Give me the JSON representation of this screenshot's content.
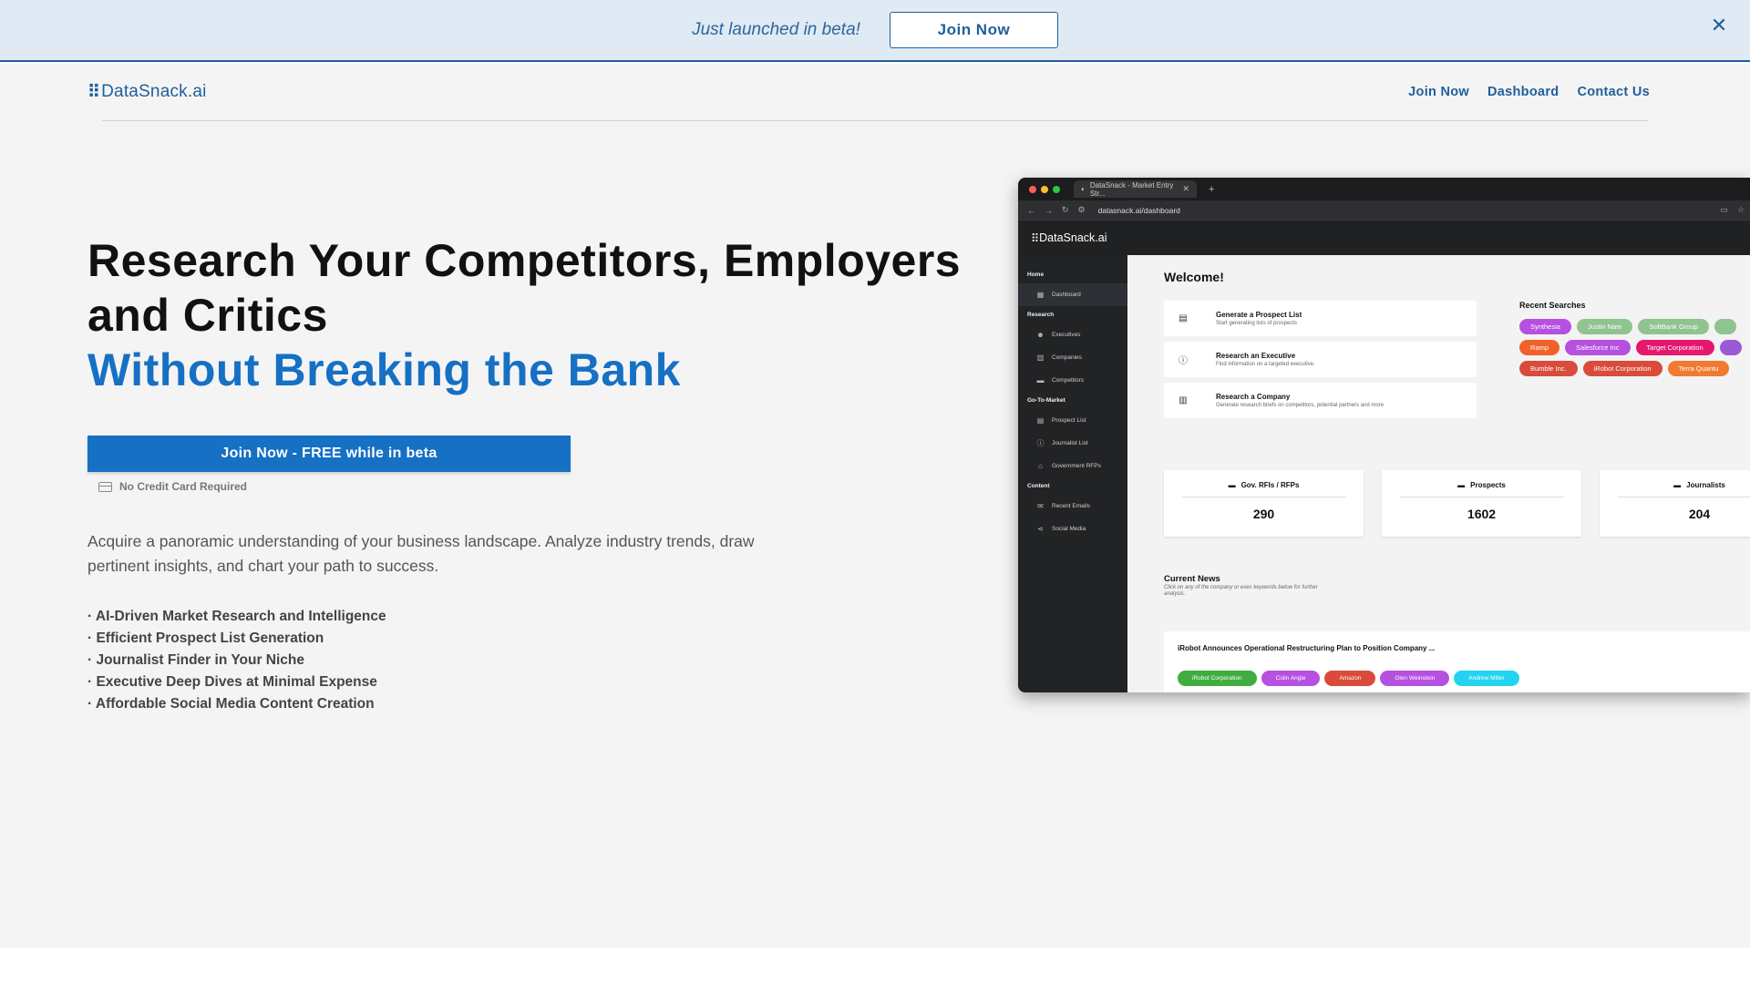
{
  "banner": {
    "text": "Just launched in beta!",
    "button": "Join Now",
    "close": "✕"
  },
  "nav": {
    "logo_mark": "⠿",
    "logo": "DataSnack.ai",
    "links": [
      "Join Now",
      "Dashboard",
      "Contact Us"
    ]
  },
  "hero": {
    "title_line1": "Research Your Competitors, Employers",
    "title_line2": "and Critics",
    "title_accent": "Without Breaking the Bank",
    "cta": "Join Now - FREE while in beta",
    "no_card": "No Credit Card Required",
    "description": "Acquire a panoramic understanding of your business landscape. Analyze industry trends, draw pertinent insights, and chart your path to success.",
    "features": [
      "· AI-Driven Market Research and Intelligence",
      "· Efficient Prospect List Generation",
      "· Journalist Finder in Your Niche",
      "· Executive Deep Dives at Minimal Expense",
      "· Affordable Social Media Content Creation"
    ]
  },
  "mock": {
    "tab_title": "DataSnack - Market Entry Str...",
    "url": "datasnack.ai/dashboard",
    "app_logo": "DataSnack.ai",
    "sidebar": {
      "home": "Home",
      "dashboard": "Dashboard",
      "research": "Research",
      "executives": "Executives",
      "companies": "Companies",
      "competitors": "Competitors",
      "gtm": "Go-To-Market",
      "prospect_list": "Prospect List",
      "journalist_list": "Journalist List",
      "gov_rfps": "Government RFPs",
      "content": "Content",
      "recent_emails": "Recent Emails",
      "social_media": "Social Media"
    },
    "welcome": "Welcome!",
    "actions": [
      {
        "title": "Generate a Prospect List",
        "sub": "Start generating lists of prospects"
      },
      {
        "title": "Research an Executive",
        "sub": "Find information on a targeted executive."
      },
      {
        "title": "Research a Company",
        "sub": "Generate research briefs on competitors, potential partners and more"
      }
    ],
    "recent_title": "Recent Searches",
    "recent": [
      {
        "label": "Synthesia",
        "color": "#b650e0"
      },
      {
        "label": "Justin Nam",
        "color": "#8fc48f"
      },
      {
        "label": "SoftBank Group",
        "color": "#8fc48f"
      },
      {
        "label": "",
        "color": "#8fc48f"
      },
      {
        "label": "Ramp",
        "color": "#f0622a"
      },
      {
        "label": "Salesforce Inc",
        "color": "#b650e0"
      },
      {
        "label": "Target Corporation",
        "color": "#e6186e"
      },
      {
        "label": "",
        "color": "#9b59d6"
      },
      {
        "label": "Bumble Inc.",
        "color": "#d94b3a"
      },
      {
        "label": "iRobot Corporation",
        "color": "#d94b3a"
      },
      {
        "label": "Terra Quantu",
        "color": "#f07a30"
      }
    ],
    "stats": [
      {
        "label": "Gov. RFIs / RFPs",
        "value": "290"
      },
      {
        "label": "Prospects",
        "value": "1602"
      },
      {
        "label": "Journalists",
        "value": "204"
      }
    ],
    "news_title": "Current News",
    "news_sub": "Click on any of the company or exec keywords below for further analysis.",
    "news_headline": "iRobot Announces Operational Restructuring Plan to Position Company ...",
    "news_tags": [
      {
        "label": "iRobot Corporation",
        "color": "#3fae3f"
      },
      {
        "label": "Colin Angle",
        "color": "#b650e0"
      },
      {
        "label": "Amazon",
        "color": "#d94b3a"
      },
      {
        "label": "Glen Weinstein",
        "color": "#b650e0"
      },
      {
        "label": "Andrew Miller",
        "color": "#22d4f0"
      }
    ]
  }
}
